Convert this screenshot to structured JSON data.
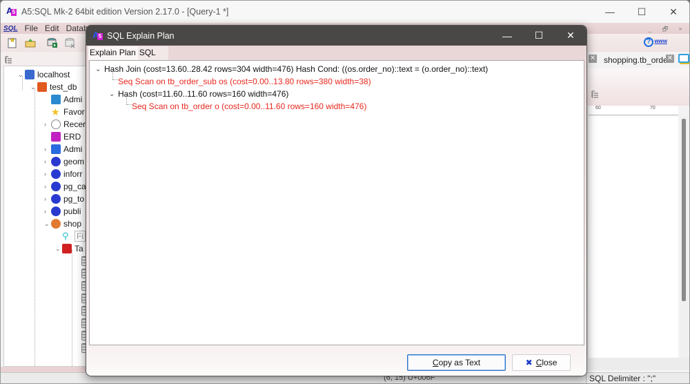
{
  "main_window": {
    "title": "A5:SQL Mk-2 64bit edition Version 2.17.0 - [Query-1 *]",
    "logo_text_a": "A",
    "logo_text_s": "5",
    "controls": {
      "minimize": "—",
      "maximize": "☐",
      "close": "✕"
    },
    "mdi_controls": {
      "minimize": "_",
      "restore": "🗗",
      "close": "×"
    }
  },
  "menubar": {
    "sql_icon": "SQL",
    "items": [
      "File",
      "Edit",
      "Databa"
    ]
  },
  "toolbar": {
    "buttons": [
      "new-query-icon",
      "open-folder-icon",
      "run-db-icon",
      "disconnect-db-icon",
      "database-icon"
    ],
    "help_icon": "?",
    "www_link": "www"
  },
  "tree": {
    "items": [
      {
        "label": "localhost",
        "icon": "server-db-icon",
        "color": "#3a6ad0",
        "expanded": true,
        "level": 0
      },
      {
        "label": "test_db",
        "icon": "database-stack-icon",
        "color": "#e05a20",
        "expanded": true,
        "level": 1
      },
      {
        "label": "Admi",
        "icon": "admin-monitor-icon",
        "color": "#2a8ad0",
        "level": 2
      },
      {
        "label": "Favor",
        "icon": "star-icon",
        "color": "#f0c020",
        "level": 2
      },
      {
        "label": "Recer",
        "icon": "clock-icon",
        "color": "#888888",
        "level": 2,
        "collapsed": true
      },
      {
        "label": "ERD",
        "icon": "erd-icon",
        "color": "#c020c0",
        "level": 2
      },
      {
        "label": "Admi",
        "icon": "admin-shapes-icon",
        "color": "#2a6ae0",
        "level": 2,
        "collapsed": true
      },
      {
        "label": "geom",
        "icon": "schema-icon",
        "color": "#2a3ad0",
        "level": 2,
        "collapsed": true
      },
      {
        "label": "inforr",
        "icon": "schema-icon",
        "color": "#2a3ad0",
        "level": 2,
        "collapsed": true
      },
      {
        "label": "pg_ca",
        "icon": "schema-icon",
        "color": "#2a3ad0",
        "level": 2,
        "collapsed": true
      },
      {
        "label": "pg_to",
        "icon": "schema-icon",
        "color": "#2a3ad0",
        "level": 2,
        "collapsed": true
      },
      {
        "label": "publi",
        "icon": "schema-icon",
        "color": "#2a3ad0",
        "level": 2,
        "collapsed": true
      },
      {
        "label": "shop",
        "icon": "schema-active-icon",
        "color": "#e07a30",
        "level": 2,
        "expanded": true
      },
      {
        "label": "Fi",
        "icon": "search-icon",
        "color": "#30c0d0",
        "level": 3
      },
      {
        "label": "Ta",
        "icon": "table-group-icon",
        "color": "#d02020",
        "level": 3,
        "expanded": true
      }
    ],
    "table_rows": 8
  },
  "right_panel": {
    "tab_label": "shopping.tb_orde",
    "ruler_marks": [
      "60",
      "70"
    ]
  },
  "statusbar": {
    "position": "(6, 15) U+006F",
    "delimiter": "SQL Delimiter : \";\""
  },
  "dialog": {
    "title": "SQL Explain Plan",
    "controls": {
      "minimize": "—",
      "maximize": "☐",
      "close": "✕"
    },
    "tabs": [
      {
        "label": "Explain Plan",
        "active": true
      },
      {
        "label": "SQL",
        "active": false
      }
    ],
    "plan": [
      {
        "text": "Hash Join  (cost=13.60..28.42 rows=304 width=476)  Hash Cond: ((os.order_no)::text = (o.order_no)::text)",
        "color": "black",
        "level": 0,
        "expandable": true
      },
      {
        "text": "Seq Scan on tb_order_sub os  (cost=0.00..13.80 rows=380 width=38)",
        "color": "red",
        "level": 1,
        "expandable": false
      },
      {
        "text": "Hash  (cost=11.60..11.60 rows=160 width=476)",
        "color": "black",
        "level": 1,
        "expandable": true
      },
      {
        "text": "Seq Scan on tb_order o  (cost=0.00..11.60 rows=160 width=476)",
        "color": "red",
        "level": 2,
        "expandable": false
      }
    ],
    "buttons": {
      "copy_prefix": "C",
      "copy_rest": "opy as Text",
      "close_icon": "✖",
      "close_prefix": "C",
      "close_rest": "lose"
    }
  },
  "colors": {
    "dialog_titlebar": "#4a4846",
    "accent_pink": "#e8d4d5",
    "plan_red": "#e8281e",
    "focus_blue": "#2a72c8"
  }
}
